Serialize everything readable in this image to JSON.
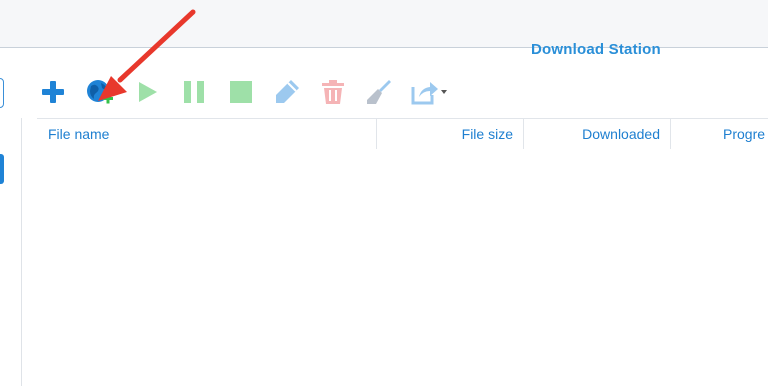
{
  "app": {
    "title": "Download Station"
  },
  "toolbar": {
    "buttons": [
      {
        "icon": "plus-icon",
        "color": "#1f83d6"
      },
      {
        "icon": "globe-add-icon",
        "color": "#1f83d6"
      },
      {
        "icon": "play-icon",
        "color": "#9ee0a8"
      },
      {
        "icon": "pause-icon",
        "color": "#9ee0a8"
      },
      {
        "icon": "stop-icon",
        "color": "#9ee0a8"
      },
      {
        "icon": "pencil-icon",
        "color": "#9cc9ef"
      },
      {
        "icon": "trash-icon",
        "color": "#f5b4b6"
      },
      {
        "icon": "broom-icon",
        "color": "#b9c1cc"
      },
      {
        "icon": "share-icon",
        "color": "#9cc9ef"
      }
    ]
  },
  "grid": {
    "columns": {
      "file_name": "File name",
      "file_size": "File size",
      "downloaded": "Downloaded",
      "progress": "Progre"
    },
    "rows": []
  },
  "annotation": {
    "arrow_color": "#e8382c"
  }
}
